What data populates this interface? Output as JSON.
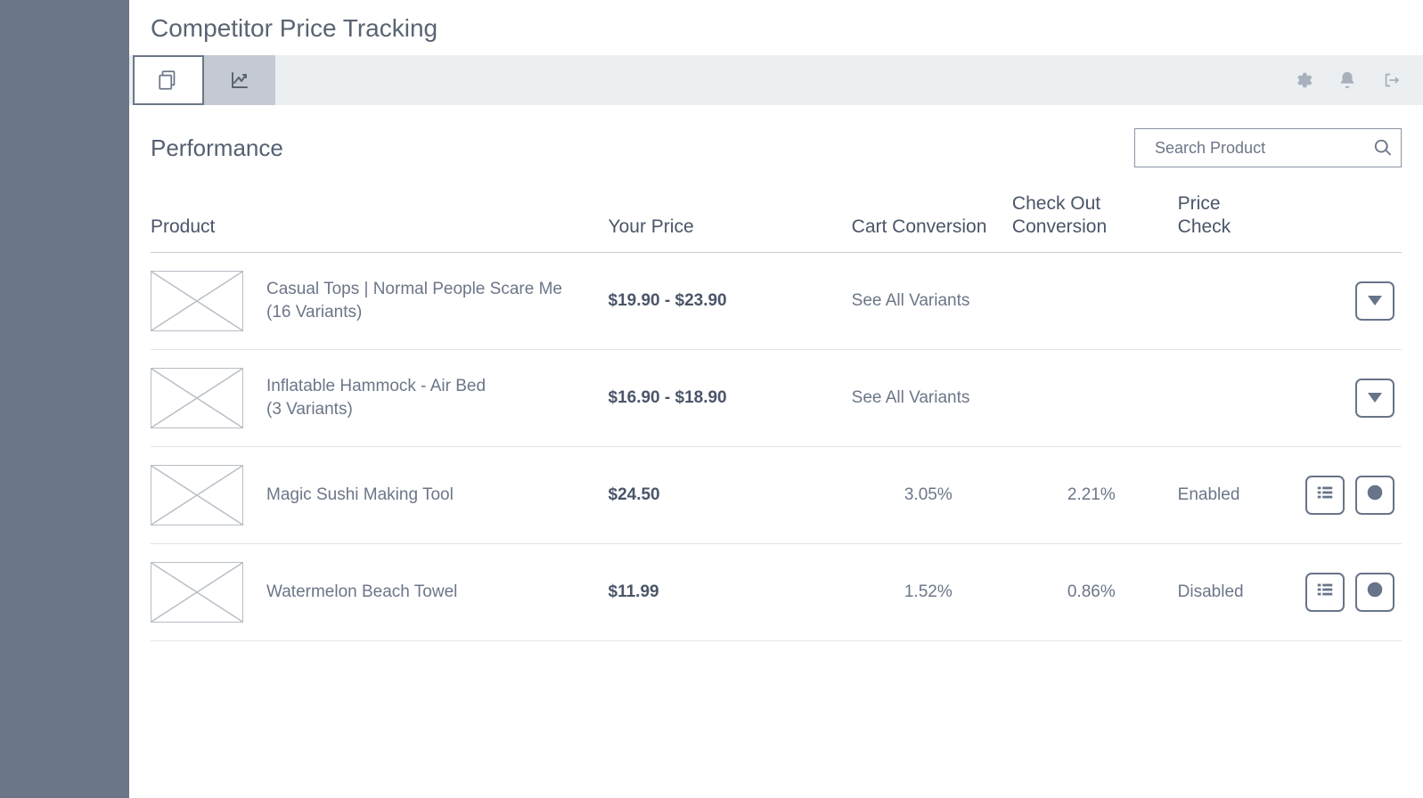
{
  "header": {
    "title": "Competitor Price Tracking"
  },
  "section": {
    "title": "Performance"
  },
  "search": {
    "placeholder": "Search Product"
  },
  "columns": {
    "product": "Product",
    "your_price": "Your Price",
    "cart_conv": "Cart Conversion",
    "checkout_conv": "Check Out Conversion",
    "price_check": "Price Check"
  },
  "rows": [
    {
      "name": "Casual Tops | Normal People Scare Me",
      "variants_label": "(16 Variants)",
      "price": "$19.90 - $23.90",
      "cart": "See All Variants",
      "checkout": "",
      "price_check": "",
      "type": "variant"
    },
    {
      "name": "Inflatable Hammock - Air Bed",
      "variants_label": "(3 Variants)",
      "price": "$16.90 - $18.90",
      "cart": "See All Variants",
      "checkout": "",
      "price_check": "",
      "type": "variant"
    },
    {
      "name": "Magic Sushi Making Tool",
      "variants_label": "",
      "price": "$24.50",
      "cart": "3.05%",
      "checkout": "2.21%",
      "price_check": "Enabled",
      "type": "single"
    },
    {
      "name": "Watermelon Beach Towel",
      "variants_label": "",
      "price": "$11.99",
      "cart": "1.52%",
      "checkout": "0.86%",
      "price_check": "Disabled",
      "type": "single"
    }
  ]
}
